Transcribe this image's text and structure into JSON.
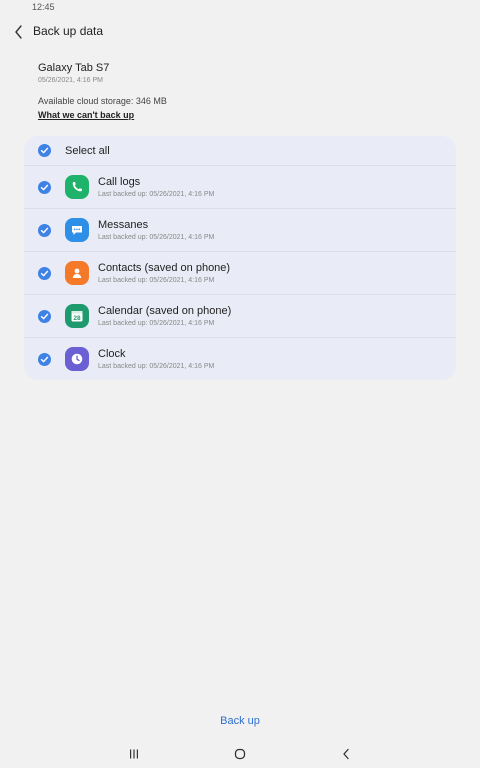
{
  "status_bar": {
    "time": "12:45"
  },
  "header": {
    "title": "Back up data"
  },
  "device": {
    "name": "Galaxy Tab S7",
    "date": "05/26/2021, 4:16 PM",
    "storage": "Available cloud storage: 346 MB",
    "cant_backup_link": "What we can't back up"
  },
  "list": {
    "select_all": {
      "label": "Select all",
      "checked": true
    },
    "items": [
      {
        "title": "Call logs",
        "sub": "Last backed up: 05/26/2021, 4:16 PM",
        "icon": "phone-icon",
        "color": "#1fb26a",
        "checked": true
      },
      {
        "title": "Messanes",
        "sub": "Last backed up: 05/26/2021, 4:16 PM",
        "icon": "message-icon",
        "color": "#2e8fe6",
        "checked": true
      },
      {
        "title": "Contacts (saved on phone)",
        "sub": "Last backed up: 05/26/2021, 4:16 PM",
        "icon": "contact-icon",
        "color": "#f47a2a",
        "checked": true
      },
      {
        "title": "Calendar (saved on phone)",
        "sub": "Last backed up: 05/26/2021, 4:16 PM",
        "icon": "calendar-icon",
        "color": "#1f9a6e",
        "checked": true,
        "day": "28"
      },
      {
        "title": "Clock",
        "sub": "Last backed up: 05/26/2021, 4:16 PM",
        "icon": "clock-icon",
        "color": "#6a5fd3",
        "checked": true
      }
    ]
  },
  "footer": {
    "backup_label": "Back up"
  },
  "colors": {
    "accent": "#3e82e6",
    "link": "#2f6fd1",
    "card": "#e9ecf6",
    "background": "#f1f1f1"
  }
}
